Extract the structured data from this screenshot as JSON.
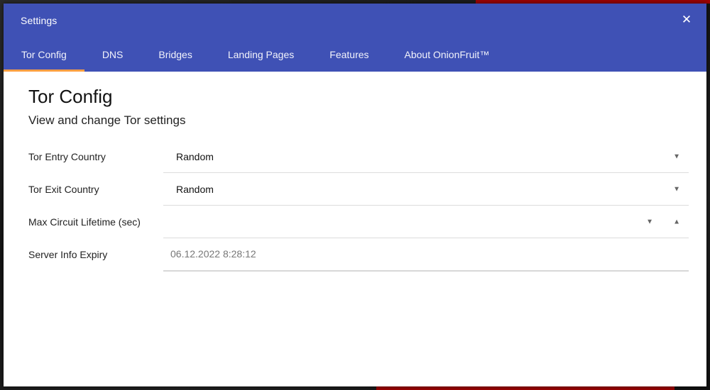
{
  "window": {
    "title": "Settings",
    "close_glyph": "✕"
  },
  "tabs": [
    {
      "label": "Tor Config",
      "active": true
    },
    {
      "label": "DNS",
      "active": false
    },
    {
      "label": "Bridges",
      "active": false
    },
    {
      "label": "Landing Pages",
      "active": false
    },
    {
      "label": "Features",
      "active": false
    },
    {
      "label": "About OnionFruit™",
      "active": false
    }
  ],
  "page": {
    "title": "Tor Config",
    "subtitle": "View and change Tor settings"
  },
  "form": {
    "entry_country": {
      "label": "Tor Entry Country",
      "value": "Random"
    },
    "exit_country": {
      "label": "Tor Exit Country",
      "value": "Random"
    },
    "circuit_lifetime": {
      "label": "Max Circuit Lifetime (sec)",
      "value": ""
    },
    "server_info_expiry": {
      "label": "Server Info Expiry",
      "value": "06.12.2022 8:28:12"
    }
  },
  "colors": {
    "header": "#3f51b5",
    "tab_indicator": "#ff9f43",
    "backdrop_accent": "#b30000"
  },
  "icons": {
    "close": "close-icon",
    "dropdown": "chevron-down-icon",
    "spin_up": "chevron-up-icon"
  }
}
